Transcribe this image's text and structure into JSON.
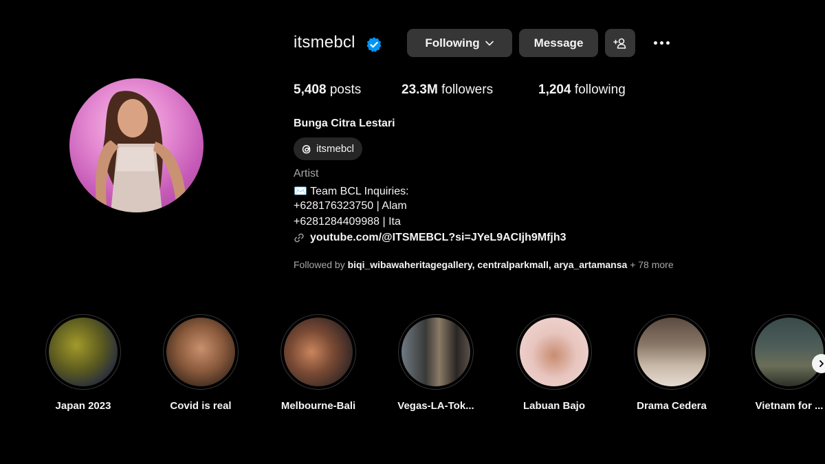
{
  "profile": {
    "username": "itsmebcl",
    "following_label": "Following",
    "message_label": "Message",
    "stats": {
      "posts_count": "5,408",
      "posts_label": "posts",
      "followers_count": "23.3M",
      "followers_label": "followers",
      "following_count": "1,204",
      "following_label": "following"
    },
    "full_name": "Bunga Citra Lestari",
    "threads_handle": "itsmebcl",
    "category": "Artist",
    "bio": [
      "✉️ Team BCL Inquiries:",
      "+628176323750 | Alam",
      "+6281284409988 | Ita"
    ],
    "link": "youtube.com/@ITSMEBCL?si=JYeL9ACIjh9Mfjh3",
    "followed_by": {
      "prefix": "Followed by",
      "users": "biqi_wibawaheritagegallery, centralparkmall, arya_artamansa",
      "more": "+ 78 more"
    }
  },
  "highlights": [
    {
      "label": "Japan 2023"
    },
    {
      "label": "Covid is real"
    },
    {
      "label": "Melbourne-Bali"
    },
    {
      "label": "Vegas-LA-Tok..."
    },
    {
      "label": "Labuan Bajo"
    },
    {
      "label": "Drama Cedera"
    },
    {
      "label": "Vietnam for ..."
    }
  ],
  "colors": {
    "background": "#000000",
    "button": "#363636",
    "verified": "#0095f6",
    "secondary_text": "#a8a8a8"
  },
  "icons": [
    "verified-badge-icon",
    "chevron-down-icon",
    "add-user-icon",
    "more-options-icon",
    "threads-icon",
    "link-icon",
    "chevron-right-icon"
  ]
}
